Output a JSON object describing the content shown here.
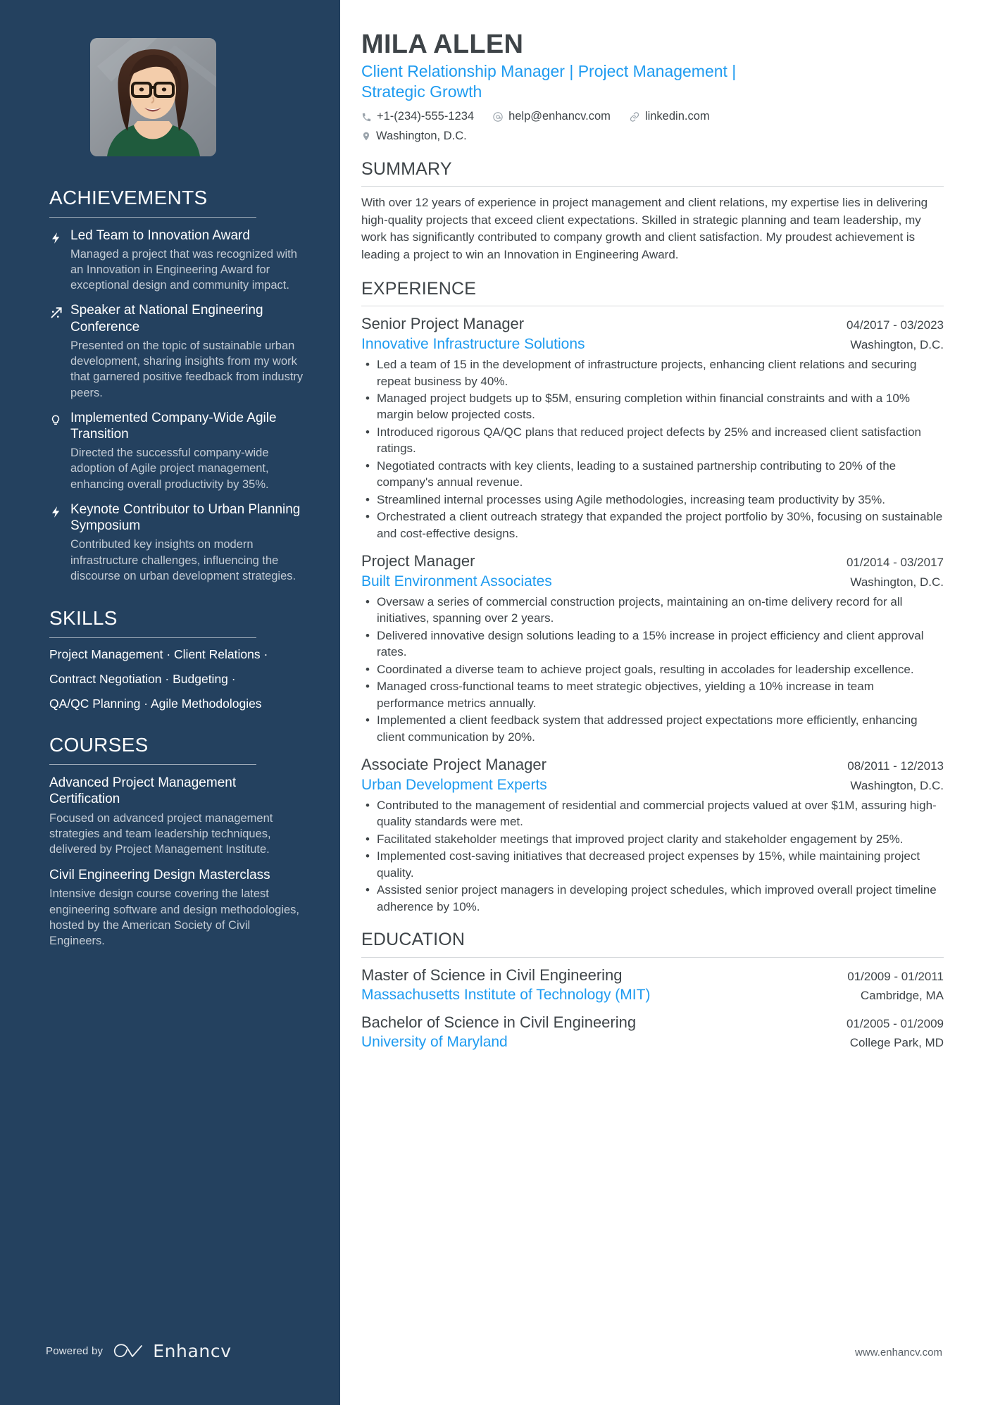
{
  "profile": {
    "name": "MILA ALLEN",
    "headline": "Client Relationship Manager | Project Management | Strategic Growth",
    "photo_alt": "portrait-photo"
  },
  "contacts": [
    {
      "icon": "phone-icon",
      "text": "+1-(234)-555-1234"
    },
    {
      "icon": "email-icon",
      "text": "help@enhancv.com"
    },
    {
      "icon": "link-icon",
      "text": "linkedin.com"
    },
    {
      "icon": "location-icon",
      "text": "Washington, D.C."
    }
  ],
  "colors": {
    "sidebar_bg": "#24415f",
    "accent_blue": "#1e9bf0",
    "body_text": "#3e4448",
    "muted_text": "#c3cbd4"
  },
  "sidebar": {
    "achievements": {
      "heading": "ACHIEVEMENTS",
      "items": [
        {
          "icon": "lightning-bolt-icon",
          "title": "Led Team to Innovation Award",
          "description": "Managed a project that was recognized with an Innovation in Engineering Award for exceptional design and community impact."
        },
        {
          "icon": "rising-arrow-icon",
          "title": "Speaker at National Engineering Conference",
          "description": "Presented on the topic of sustainable urban development, sharing insights from my work that garnered positive feedback from industry peers."
        },
        {
          "icon": "lightbulb-icon",
          "title": "Implemented Company-Wide Agile Transition",
          "description": "Directed the successful company-wide adoption of Agile project management, enhancing overall productivity by 35%."
        },
        {
          "icon": "lightning-bolt-icon",
          "title": "Keynote Contributor to Urban Planning Symposium",
          "description": "Contributed key insights on modern infrastructure challenges, influencing the discourse on urban development strategies."
        }
      ]
    },
    "skills": {
      "heading": "SKILLS",
      "lines": [
        "Project Management · Client Relations ·",
        "Contract Negotiation · Budgeting ·",
        "QA/QC Planning · Agile Methodologies"
      ]
    },
    "courses": {
      "heading": "COURSES",
      "items": [
        {
          "title": "Advanced Project Management Certification",
          "description": "Focused on advanced project management strategies and team leadership techniques, delivered by Project Management Institute."
        },
        {
          "title": "Civil Engineering Design Masterclass",
          "description": "Intensive design course covering the latest engineering software and design methodologies, hosted by the American Society of Civil Engineers."
        }
      ]
    },
    "footer": {
      "powered_by": "Powered by",
      "brand": "Enhancv"
    }
  },
  "main": {
    "summary": {
      "heading": "SUMMARY",
      "text": "With over 12 years of experience in project management and client relations, my expertise lies in delivering high-quality projects that exceed client expectations. Skilled in strategic planning and team leadership, my work has significantly contributed to company growth and client satisfaction. My proudest achievement is leading a project to win an Innovation in Engineering Award."
    },
    "experience": {
      "heading": "EXPERIENCE",
      "entries": [
        {
          "role": "Senior Project Manager",
          "date": "04/2017 - 03/2023",
          "company": "Innovative Infrastructure Solutions",
          "location": "Washington, D.C.",
          "bullets": [
            "Led a team of 15 in the development of infrastructure projects, enhancing client relations and securing repeat business by 40%.",
            "Managed project budgets up to $5M, ensuring completion within financial constraints and with a 10% margin below projected costs.",
            "Introduced rigorous QA/QC plans that reduced project defects by 25% and increased client satisfaction ratings.",
            "Negotiated contracts with key clients, leading to a sustained partnership contributing to 20% of the company's annual revenue.",
            "Streamlined internal processes using Agile methodologies, increasing team productivity by 35%.",
            "Orchestrated a client outreach strategy that expanded the project portfolio by 30%, focusing on sustainable and cost-effective designs."
          ]
        },
        {
          "role": "Project Manager",
          "date": "01/2014 - 03/2017",
          "company": "Built Environment Associates",
          "location": "Washington, D.C.",
          "bullets": [
            "Oversaw a series of commercial construction projects, maintaining an on-time delivery record for all initiatives, spanning over 2 years.",
            "Delivered innovative design solutions leading to a 15% increase in project efficiency and client approval rates.",
            "Coordinated a diverse team to achieve project goals, resulting in accolades for leadership excellence.",
            "Managed cross-functional teams to meet strategic objectives, yielding a 10% increase in team performance metrics annually.",
            "Implemented a client feedback system that addressed project expectations more efficiently, enhancing client communication by 20%."
          ]
        },
        {
          "role": "Associate Project Manager",
          "date": "08/2011 - 12/2013",
          "company": "Urban Development Experts",
          "location": "Washington, D.C.",
          "bullets": [
            "Contributed to the management of residential and commercial projects valued at over $1M, assuring high-quality standards were met.",
            "Facilitated stakeholder meetings that improved project clarity and stakeholder engagement by 25%.",
            "Implemented cost-saving initiatives that decreased project expenses by 15%, while maintaining project quality.",
            "Assisted senior project managers in developing project schedules, which improved overall project timeline adherence by 10%."
          ]
        }
      ]
    },
    "education": {
      "heading": "EDUCATION",
      "entries": [
        {
          "degree": "Master of Science in Civil Engineering",
          "date": "01/2009 - 01/2011",
          "school": "Massachusetts Institute of Technology (MIT)",
          "location": "Cambridge, MA"
        },
        {
          "degree": "Bachelor of Science in Civil Engineering",
          "date": "01/2005 - 01/2009",
          "school": "University of Maryland",
          "location": "College Park, MD"
        }
      ]
    },
    "footer": {
      "website": "www.enhancv.com"
    }
  }
}
